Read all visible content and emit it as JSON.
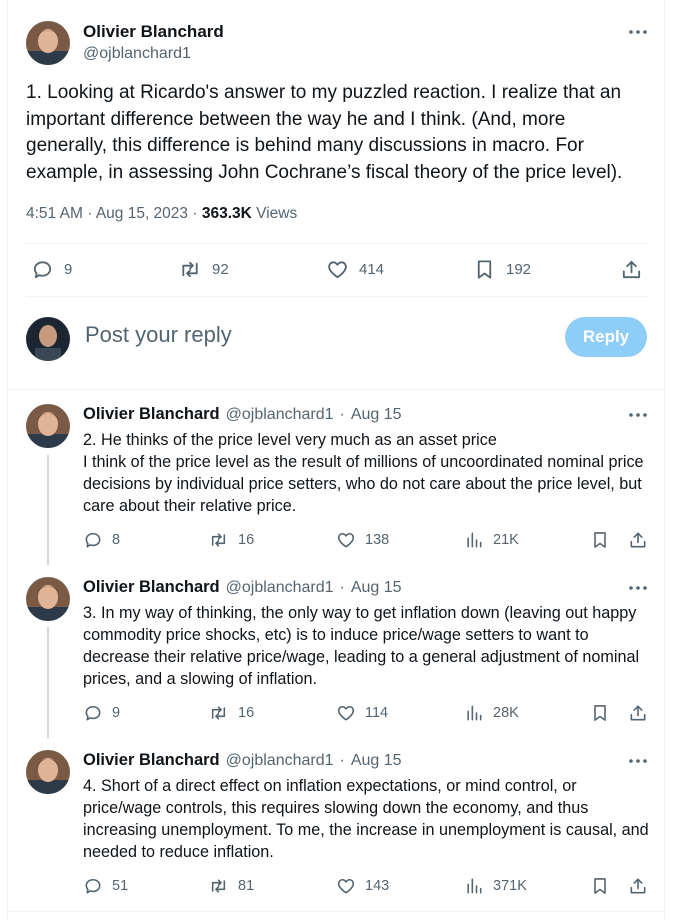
{
  "main_tweet": {
    "author_name": "Olivier Blanchard",
    "author_handle": "@ojblanchard1",
    "text": "1. Looking at Ricardo's answer to my puzzled reaction.  I realize that an important difference between the way he and I think. (And, more generally, this difference is behind many discussions in macro.  For example, in assessing John Cochrane’s fiscal theory of the price level).",
    "time": "4:51 AM",
    "date": "Aug 15, 2023",
    "sep1": "·",
    "sep2": "·",
    "views_count": "363.3K",
    "views_label": "Views",
    "replies": "9",
    "reposts": "92",
    "likes": "414",
    "bookmarks": "192"
  },
  "compose": {
    "placeholder": "Post your reply",
    "button": "Reply"
  },
  "replies": [
    {
      "author_name": "Olivier Blanchard",
      "author_handle": "@ojblanchard1",
      "sep": "·",
      "date": "Aug 15",
      "text": "2. He thinks of the price level very much as an asset price\nI think of the price level as the result of millions of uncoordinated nominal price decisions by individual price setters, who do not care about the price level, but care about their relative price.",
      "replies": "8",
      "reposts": "16",
      "likes": "138",
      "views": "21K"
    },
    {
      "author_name": "Olivier Blanchard",
      "author_handle": "@ojblanchard1",
      "sep": "·",
      "date": "Aug 15",
      "text": "3. In my way of thinking, the only way to get inflation down (leaving out happy commodity price shocks, etc) is to induce price/wage setters to want to decrease their relative price/wage, leading to a general adjustment of nominal prices, and a slowing of inflation.",
      "replies": "9",
      "reposts": "16",
      "likes": "114",
      "views": "28K"
    },
    {
      "author_name": "Olivier Blanchard",
      "author_handle": "@ojblanchard1",
      "sep": "·",
      "date": "Aug 15",
      "text": "4. Short of a direct effect on inflation expectations, or mind control, or price/wage controls, this requires slowing down the economy, and thus increasing unemployment. To me, the increase in unemployment is causal, and needed to reduce inflation.",
      "replies": "51",
      "reposts": "81",
      "likes": "143",
      "views": "371K"
    }
  ],
  "icons": {
    "more": "more-dots-icon",
    "reply": "speech-bubble-icon",
    "repost": "repost-arrows-icon",
    "like": "heart-icon",
    "bookmark": "bookmark-icon",
    "share": "share-upload-icon",
    "views": "bar-chart-icon"
  },
  "colors": {
    "accent_light": "#8ecdf7",
    "text_primary": "#0f1419",
    "text_secondary": "#536471",
    "divider": "#eff3f4"
  }
}
